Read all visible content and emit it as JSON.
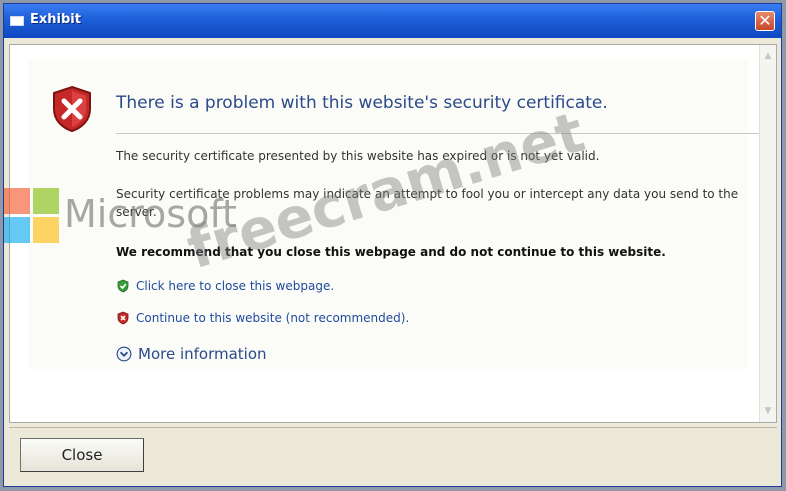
{
  "window": {
    "title": "Exhibit",
    "close_glyph": "✕"
  },
  "page": {
    "headline": "There is a problem with this website's security certificate.",
    "paragraph1": "The security certificate presented by this website has expired or is not yet valid.",
    "paragraph2": "Security certificate problems may indicate an attempt to fool you or intercept any data you send to the server.",
    "recommendation": "We recommend that you close this webpage and do not continue to this website.",
    "close_link": "Click here to close this webpage.",
    "continue_link": "Continue to this website (not recommended).",
    "more_info": "More information"
  },
  "footer": {
    "close_button": "Close"
  },
  "watermark": {
    "microsoft": "Microsoft",
    "site": "freecram.net"
  },
  "icons": {
    "title_icon": "window-icon",
    "shield": "shield-error-icon",
    "green_shield": "shield-ok-icon",
    "red_shield": "shield-error-small-icon",
    "more_info": "expand-circle-icon"
  },
  "colors": {
    "title_bar": "#1d5fd8",
    "headline": "#2b4a8a",
    "link": "#1f4b9c",
    "shield_red": "#c62828",
    "shield_green": "#3a9b3a"
  }
}
